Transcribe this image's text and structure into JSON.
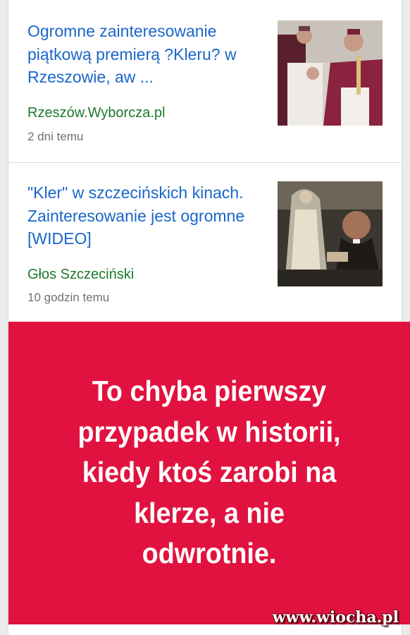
{
  "articles": [
    {
      "headline": "Ogromne zainteresowanie piątkową premierą ?Kleru? w Rzeszowie, aw ...",
      "source": "Rzeszów.Wyborcza.pl",
      "age": "2 dni temu"
    },
    {
      "headline": "\"Kler\" w szczecińskich kinach. Zainteresowanie jest ogromne [WIDEO]",
      "source": "Głos Szczeciński",
      "age": "10 godzin temu"
    }
  ],
  "banner": {
    "text": "To chyba pierwszy\nprzypadek w historii,\nkiedy ktoś zarobi na\nklerze, a nie\nodwrotnie."
  },
  "watermark": "www.wiocha.pl",
  "colors": {
    "headline": "#1a66c9",
    "source": "#1e7a2c",
    "banner": "#e1123f"
  }
}
